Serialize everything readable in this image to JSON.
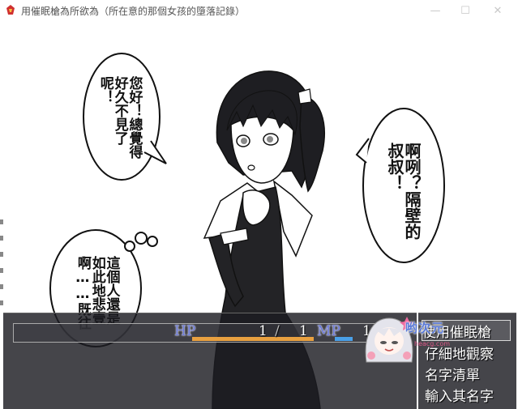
{
  "window": {
    "title": "用催眠槍為所欲為（所在意的那個女孩的墮落記錄）",
    "minimize_icon": "minimize-icon",
    "maximize_icon": "maximize-icon",
    "close_icon": "close-icon"
  },
  "speech": {
    "left_top": "您好！總覺得好久不見了呢！",
    "right": "啊咧？隔壁的叔叔！",
    "thought": "這個人還是如此地悲壹啊……既往"
  },
  "status": {
    "hp_label": "HP",
    "hp_current": "1",
    "hp_sep": "/",
    "hp_max": "1",
    "mp_label": "MP",
    "mp_value": "1",
    "hp_fill": 1.0,
    "mp_fill": 0.2,
    "hp_color": "#e8a040",
    "mp_color": "#4aa0e8"
  },
  "menu": {
    "items": [
      {
        "label": "使用催眠槍"
      },
      {
        "label": "仔細地觀察"
      },
      {
        "label": "名字清單"
      },
      {
        "label": "輸入其名字"
      }
    ]
  },
  "watermark": {
    "title": "哟次元",
    "sub": "heacg.com"
  }
}
